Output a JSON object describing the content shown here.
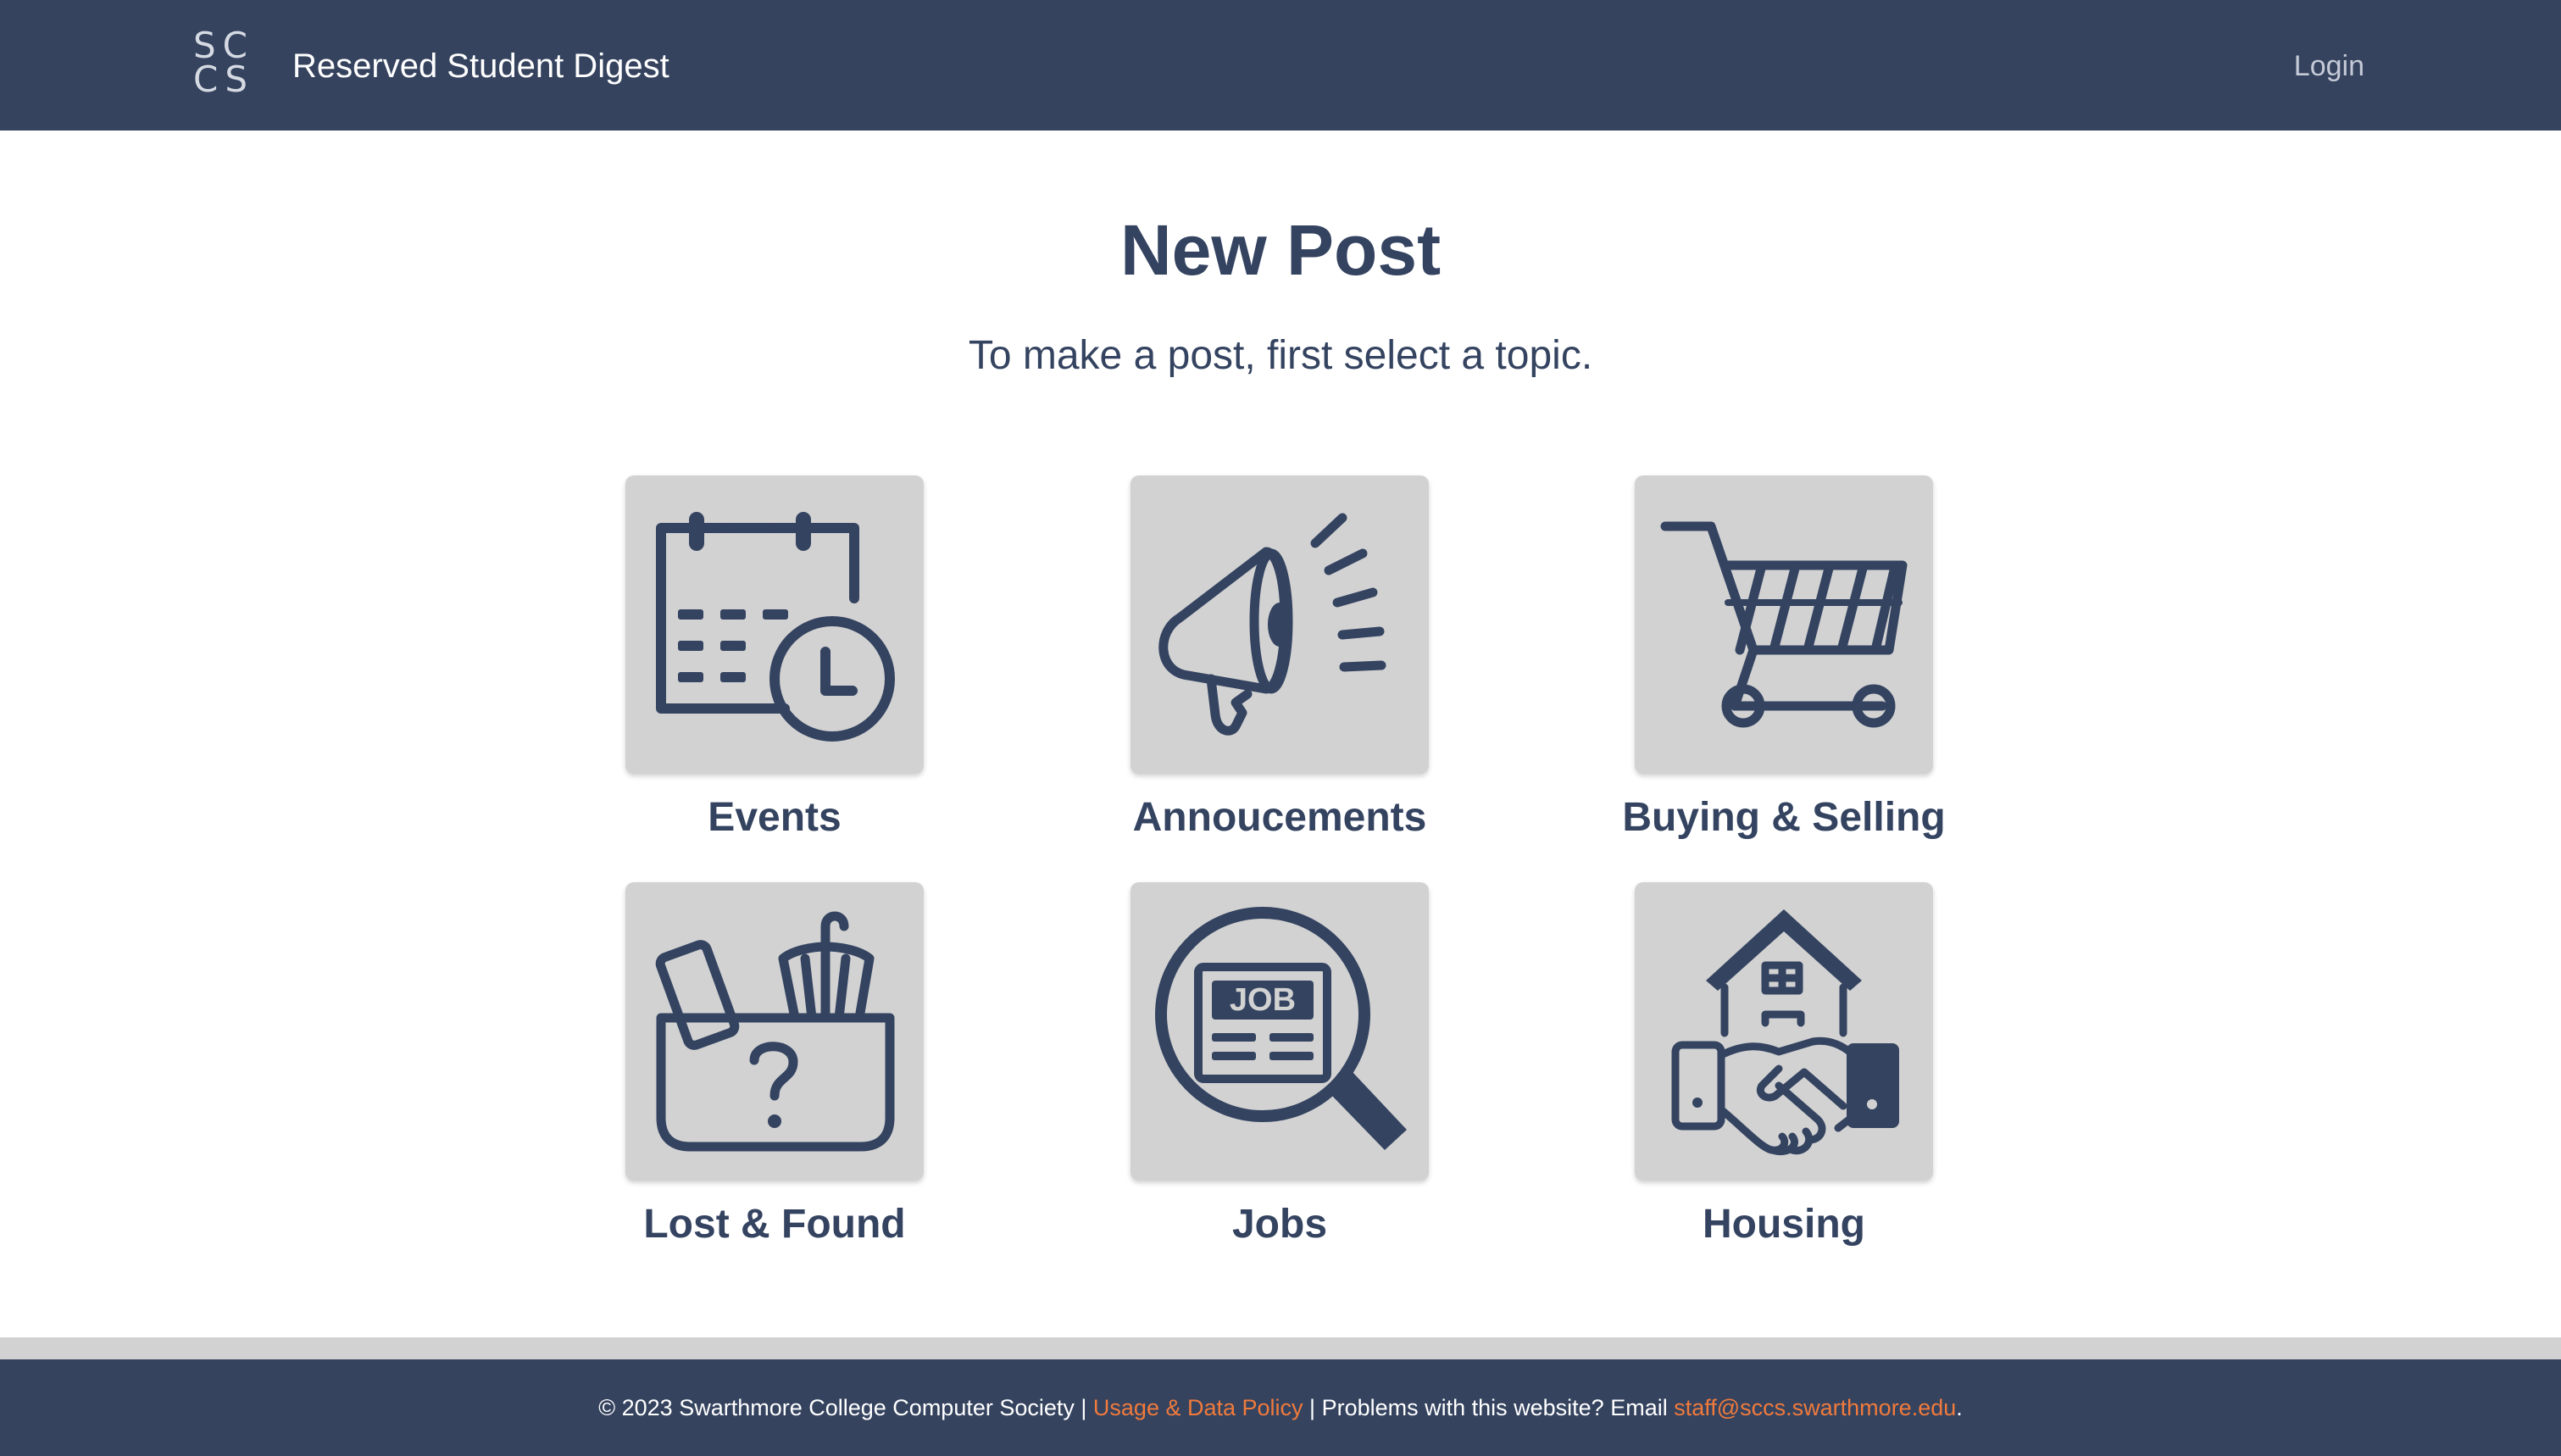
{
  "header": {
    "logo_line1": "SC",
    "logo_line2": "CS",
    "site_title": "Reserved Student Digest",
    "login_label": "Login"
  },
  "main": {
    "title": "New Post",
    "subtitle": "To make a post, first select a topic.",
    "topics": [
      {
        "label": "Events",
        "icon": "calendar-clock-icon"
      },
      {
        "label": "Annoucements",
        "icon": "megaphone-icon"
      },
      {
        "label": "Buying & Selling",
        "icon": "shopping-cart-icon"
      },
      {
        "label": "Lost & Found",
        "icon": "lost-found-basket-icon"
      },
      {
        "label": "Jobs",
        "icon": "job-search-icon"
      },
      {
        "label": "Housing",
        "icon": "house-handshake-icon"
      }
    ]
  },
  "footer": {
    "copyright": "© 2023 Swarthmore College Computer Society | ",
    "policy_link": "Usage & Data Policy",
    "problems_text": " | Problems with this website? Email ",
    "email_link": "staff@sccs.swarthmore.edu",
    "end_period": "."
  },
  "colors": {
    "navbar": "#35435f",
    "text": "#344360",
    "tile": "#d2d2d2",
    "link_accent": "#f07a3c"
  }
}
